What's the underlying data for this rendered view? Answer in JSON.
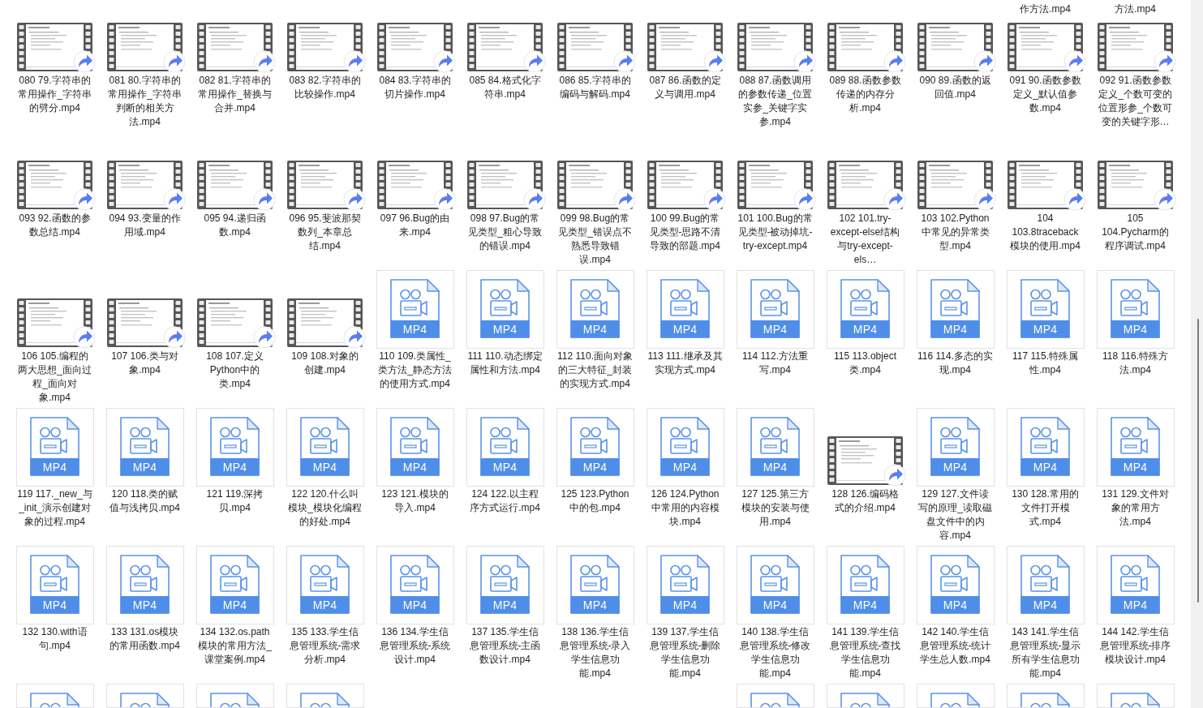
{
  "rows": [
    {
      "cells": [
        {
          "kind": "blank"
        },
        {
          "kind": "blank"
        },
        {
          "kind": "blank"
        },
        {
          "kind": "blank"
        },
        {
          "kind": "blank"
        },
        {
          "kind": "blank"
        },
        {
          "kind": "blank"
        },
        {
          "kind": "blank"
        },
        {
          "kind": "blank"
        },
        {
          "kind": "blank"
        },
        {
          "kind": "blank"
        },
        {
          "kind": "label_only",
          "label": "作方法.mp4"
        },
        {
          "kind": "label_only",
          "label": "方法.mp4"
        }
      ]
    },
    {
      "cells": [
        {
          "kind": "video_thumbnail",
          "label": "080 79.字符串的常用操作_字符串的劈分.mp4"
        },
        {
          "kind": "video_thumbnail",
          "label": "081 80.字符串的常用操作_字符串判断的相关方法.mp4"
        },
        {
          "kind": "video_thumbnail",
          "label": "082 81.字符串的常用操作_替换与合并.mp4"
        },
        {
          "kind": "video_thumbnail",
          "label": "083 82.字符串的比较操作.mp4"
        },
        {
          "kind": "video_thumbnail",
          "label": "084 83.字符串的切片操作.mp4"
        },
        {
          "kind": "video_thumbnail",
          "label": "085 84.格式化字符串.mp4"
        },
        {
          "kind": "video_thumbnail",
          "label": "086 85.字符串的编码与解码.mp4"
        },
        {
          "kind": "video_thumbnail",
          "label": "087 86.函数的定义与调用.mp4"
        },
        {
          "kind": "video_thumbnail",
          "label": "088 87.函数调用的参数传递_位置实参_关键字实参.mp4"
        },
        {
          "kind": "video_thumbnail",
          "label": "089 88.函数参数传递的内存分析.mp4"
        },
        {
          "kind": "video_thumbnail",
          "label": "090 89.函数的返回值.mp4"
        },
        {
          "kind": "video_thumbnail",
          "label": "091 90.函数参数定义_默认值参数.mp4"
        },
        {
          "kind": "video_thumbnail",
          "label": "092 91.函数参数定义_个数可变的位置形参_个数可变的关键字形…"
        }
      ]
    },
    {
      "cells": [
        {
          "kind": "video_thumbnail",
          "label": "093 92.函数的参数总结.mp4"
        },
        {
          "kind": "video_thumbnail",
          "label": "094 93.变量的作用域.mp4"
        },
        {
          "kind": "video_thumbnail",
          "label": "095 94.递归函数.mp4"
        },
        {
          "kind": "video_thumbnail",
          "label": "096 95.斐波那契数列_本章总结.mp4"
        },
        {
          "kind": "video_thumbnail",
          "label": "097 96.Bug的由来.mp4"
        },
        {
          "kind": "video_thumbnail",
          "label": "098 97.Bug的常见类型_粗心导致的错误.mp4"
        },
        {
          "kind": "video_thumbnail",
          "label": "099 98.Bug的常见类型_错误点不熟悉导致错误.mp4"
        },
        {
          "kind": "video_thumbnail",
          "label": "100 99.Bug的常见类型-思路不清导致的部题.mp4"
        },
        {
          "kind": "video_thumbnail",
          "label": "101 100.Bug的常见类型-被动掉坑-try-except.mp4"
        },
        {
          "kind": "video_thumbnail",
          "label": "102 101.try-except-else结构与try-except-els…"
        },
        {
          "kind": "video_thumbnail",
          "label": "103 102.Python中常见的异常类型.mp4"
        },
        {
          "kind": "video_thumbnail",
          "label": "104 103.8traceback模块的使用.mp4"
        },
        {
          "kind": "video_thumbnail",
          "label": "105 104.Pycharm的程序调试.mp4"
        }
      ]
    },
    {
      "cells": [
        {
          "kind": "video_thumbnail",
          "label": "106 105.编程的两大思想_面向过程_面向对象.mp4"
        },
        {
          "kind": "video_thumbnail",
          "label": "107 106.类与对象.mp4"
        },
        {
          "kind": "video_thumbnail",
          "label": "108 107.定义Python中的类.mp4"
        },
        {
          "kind": "video_thumbnail",
          "label": "109 108.对象的创建.mp4"
        },
        {
          "kind": "mp4_icon",
          "icon_text": "MP4",
          "label": "110 109.类属性_类方法_静态方法的使用方式.mp4"
        },
        {
          "kind": "mp4_icon",
          "icon_text": "MP4",
          "label": "111 110.动态绑定属性和方法.mp4"
        },
        {
          "kind": "mp4_icon",
          "icon_text": "MP4",
          "label": "112 110.面向对象的三大特征_封装的实现方式.mp4"
        },
        {
          "kind": "mp4_icon",
          "icon_text": "MP4",
          "label": "113 111.继承及其实现方式.mp4"
        },
        {
          "kind": "mp4_icon",
          "icon_text": "MP4",
          "label": "114 112.方法重写.mp4"
        },
        {
          "kind": "mp4_icon",
          "icon_text": "MP4",
          "label": "115 113.object类.mp4"
        },
        {
          "kind": "mp4_icon",
          "icon_text": "MP4",
          "label": "116 114.多态的实现.mp4"
        },
        {
          "kind": "mp4_icon",
          "icon_text": "MP4",
          "label": "117 115.特殊属性.mp4"
        },
        {
          "kind": "mp4_icon",
          "icon_text": "MP4",
          "label": "118 116.特殊方法.mp4"
        }
      ]
    },
    {
      "cells": [
        {
          "kind": "mp4_icon",
          "icon_text": "MP4",
          "label": "119 117._new_与_init_演示创建对象的过程.mp4"
        },
        {
          "kind": "mp4_icon",
          "icon_text": "MP4",
          "label": "120 118.类的赋值与浅拷贝.mp4"
        },
        {
          "kind": "mp4_icon",
          "icon_text": "MP4",
          "label": "121 119.深拷贝.mp4"
        },
        {
          "kind": "mp4_icon",
          "icon_text": "MP4",
          "label": "122 120.什么叫模块_模块化编程的好处.mp4"
        },
        {
          "kind": "mp4_icon",
          "icon_text": "MP4",
          "label": "123 121.模块的导入.mp4"
        },
        {
          "kind": "mp4_icon",
          "icon_text": "MP4",
          "label": "124 122.以主程序方式运行.mp4"
        },
        {
          "kind": "mp4_icon",
          "icon_text": "MP4",
          "label": "125 123.Python中的包.mp4"
        },
        {
          "kind": "mp4_icon",
          "icon_text": "MP4",
          "label": "126 124.Python中常用的内容模块.mp4"
        },
        {
          "kind": "mp4_icon",
          "icon_text": "MP4",
          "label": "127 125.第三方模块的安装与使用.mp4"
        },
        {
          "kind": "video_thumbnail",
          "label": "128 126.编码格式的介绍.mp4"
        },
        {
          "kind": "mp4_icon",
          "icon_text": "MP4",
          "label": "129 127.文件读写的原理_读取磁盘文件中的内容.mp4"
        },
        {
          "kind": "mp4_icon",
          "icon_text": "MP4",
          "label": "130 128.常用的文件打开模式.mp4"
        },
        {
          "kind": "mp4_icon",
          "icon_text": "MP4",
          "label": "131 129.文件对象的常用方法.mp4"
        }
      ]
    },
    {
      "cells": [
        {
          "kind": "mp4_icon",
          "icon_text": "MP4",
          "label": "132 130.with语句.mp4"
        },
        {
          "kind": "mp4_icon",
          "icon_text": "MP4",
          "label": "133 131.os模块的常用函数.mp4"
        },
        {
          "kind": "mp4_icon",
          "icon_text": "MP4",
          "label": "134 132.os.path模块的常用方法_课堂案例.mp4"
        },
        {
          "kind": "mp4_icon",
          "icon_text": "MP4",
          "label": "135 133.学生信息管理系统-需求分析.mp4"
        },
        {
          "kind": "mp4_icon",
          "icon_text": "MP4",
          "label": "136 134.学生信息管理系统-系统设计.mp4"
        },
        {
          "kind": "mp4_icon",
          "icon_text": "MP4",
          "label": "137 135.学生信息管理系统-主函数设计.mp4"
        },
        {
          "kind": "mp4_icon",
          "icon_text": "MP4",
          "label": "138 136.学生信息管理系统-录入学生信息功能.mp4"
        },
        {
          "kind": "mp4_icon",
          "icon_text": "MP4",
          "label": "139 137.学生信息管理系统-删除学生信息功能.mp4"
        },
        {
          "kind": "mp4_icon",
          "icon_text": "MP4",
          "label": "140 138.学生信息管理系统-修改学生信息功能.mp4"
        },
        {
          "kind": "mp4_icon",
          "icon_text": "MP4",
          "label": "141 139.学生信息管理系统-查找学生信息功能.mp4"
        },
        {
          "kind": "mp4_icon",
          "icon_text": "MP4",
          "label": "142 140.学生信息管理系统-统计学生总人数.mp4"
        },
        {
          "kind": "mp4_icon",
          "icon_text": "MP4",
          "label": "143 141.学生信息管理系统-显示所有学生信息功能.mp4"
        },
        {
          "kind": "mp4_icon",
          "icon_text": "MP4",
          "label": "144 142.学生信息管理系统-排序模块设计.mp4"
        }
      ]
    },
    {
      "cells": [
        {
          "kind": "mp4_icon"
        },
        {
          "kind": "mp4_icon"
        },
        {
          "kind": "mp4_icon"
        },
        {
          "kind": "mp4_icon"
        },
        {
          "kind": "blank"
        },
        {
          "kind": "blank"
        },
        {
          "kind": "blank"
        },
        {
          "kind": "blank"
        },
        {
          "kind": "mp4_icon"
        },
        {
          "kind": "mp4_icon"
        },
        {
          "kind": "mp4_icon"
        },
        {
          "kind": "mp4_icon"
        },
        {
          "kind": "mp4_icon"
        }
      ]
    }
  ]
}
